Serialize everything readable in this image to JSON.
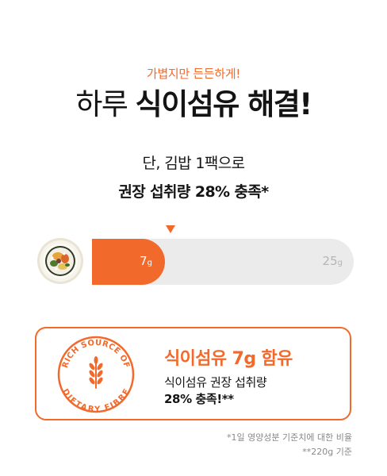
{
  "tagline": "가볍지만 든든하게!",
  "headline": {
    "light": "하루 ",
    "bold": "식이섬유 해결!"
  },
  "subtitle_line1": "단, 김밥 1팩으로",
  "subtitle_line2": "권장 섭취량 28% 충족*",
  "progress": {
    "value": 7,
    "max": 25,
    "fraction": 0.28,
    "value_number": "7",
    "value_unit": "g",
    "max_number": "25",
    "max_unit": "g",
    "colors": {
      "fill": "#f26a2b",
      "track": "#ebebeb"
    }
  },
  "card": {
    "title": "식이섬유 7g 함유",
    "line1": "식이섬유 권장 섭취량",
    "line2": "28% 충족!**",
    "badge_text_top": "RICH SOURCE OF",
    "badge_text_bottom": "DIETARY FIBRE",
    "badge_icon": "wheat-icon"
  },
  "footnotes": {
    "note1": "*1일 영양성분 기준치에 대한 비율",
    "note2": "**220g 기준"
  },
  "colors": {
    "accent": "#f26a2b",
    "text": "#141414",
    "muted": "#8a8a8a"
  }
}
